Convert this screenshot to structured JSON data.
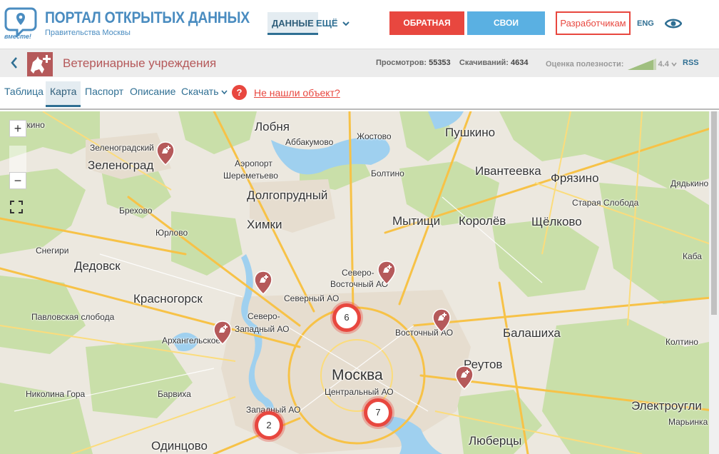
{
  "header": {
    "logo_subtitle": "вместе!",
    "portal_title": "ПОРТАЛ ОТКРЫТЫХ ДАННЫХ",
    "portal_subtitle": "Правительства Москвы",
    "nav_data": "ДАННЫЕ",
    "nav_more": "ЕЩЁ",
    "feedback_label": "ОБРАТНАЯ СВЯЗЬ",
    "products_label": "СВОИ ПРОДУКТЫ!",
    "developers_label": "Разработчикам",
    "lang_label": "ENG"
  },
  "dataset": {
    "title": "Ветеринарные учреждения",
    "views_label": "Просмотров:",
    "views_value": "55353",
    "downloads_label": "Скачиваний:",
    "downloads_value": "4634",
    "rating_label": "Оценка полезности:",
    "rating_value": "4.4",
    "rss_label": "RSS"
  },
  "tabs": {
    "table": "Таблица",
    "map": "Карта",
    "passport": "Паспорт",
    "description": "Описание",
    "download": "Скачать",
    "help_glyph": "?",
    "not_found": "Не нашли объект?"
  },
  "map": {
    "zoom_in": "+",
    "zoom_out": "−",
    "labels": {
      "lobnya": "Лобня",
      "pushkino": "Пушкино",
      "zelenograd_ao": "Зеленоградский",
      "zelenograd": "Зеленоград",
      "abbakumovo": "Аббакумово",
      "zhostovo": "Жостово",
      "airport": "Аэропорт",
      "sheremetyevo": "Шереметьево",
      "boltino": "Болтино",
      "ivanteevka": "Ивантеевка",
      "fryazino": "Фрязино",
      "dyadkino": "Дядькино",
      "dolgoprudny": "Долгопрудный",
      "brekhovo": "Брехово",
      "staraya_sloboda": "Старая Слобода",
      "khimki": "Химки",
      "mytishchi": "Мытищи",
      "korolev": "Королёв",
      "shchelkovo": "Щёлково",
      "yurlovo": "Юрлово",
      "snegiri": "Снегири",
      "kab": "Каба",
      "dedovsk": "Дедовск",
      "severo_vostochny_1": "Северо-",
      "severo_vostochny_2": "Восточный АО",
      "severny_ao": "Северный АО",
      "krasnogorsk": "Красногорск",
      "severo_zapadny_1": "Северо-",
      "severo_zapadny_2": "Западный АО",
      "pavlovskaya": "Павловская слобода",
      "vostochny_ao": "Восточный АО",
      "balashikha": "Балашиха",
      "arkhangelskoe": "Архангельское",
      "koltino": "Колтино",
      "reutov": "Реутов",
      "moskva": "Москва",
      "tsentralny_ao": "Центральный АО",
      "nikolina_gora": "Николина Гора",
      "barvikha": "Барвиха",
      "elektrougli": "Электроугли",
      "zapadny_ao": "Западный АО",
      "marinka": "Марьинка",
      "odintsovo": "Одинцово",
      "lyubertsy": "Люберцы",
      "tkino": "ткино"
    },
    "clusters": {
      "c1": "6",
      "c2": "7",
      "c3": "2"
    }
  },
  "colors": {
    "brand_blue": "#4a8cc0",
    "accent_red": "#e8473f",
    "dataset_red": "#b5595a"
  }
}
